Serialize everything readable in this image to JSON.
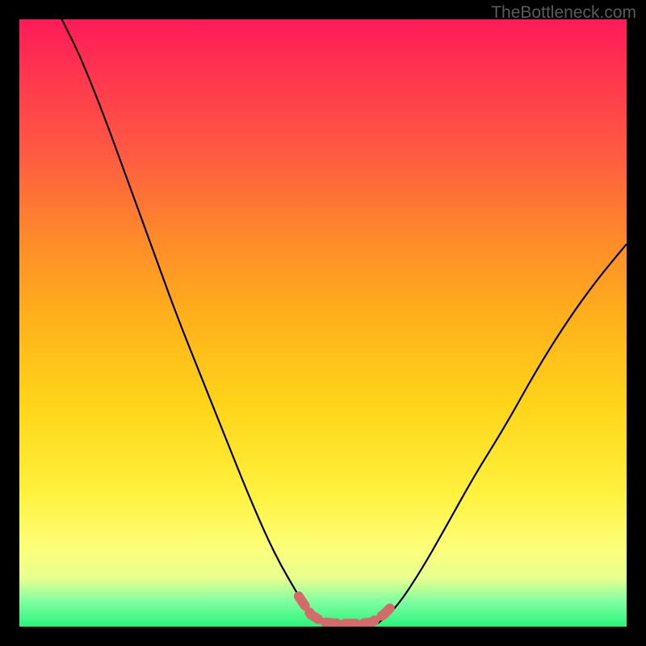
{
  "watermark": "TheBottleneck.com",
  "chart_data": {
    "type": "line",
    "title": "",
    "xlabel": "",
    "ylabel": "",
    "xlim": [
      0,
      100
    ],
    "ylim": [
      0,
      100
    ],
    "series": [
      {
        "name": "left-curve",
        "type": "line",
        "points": [
          {
            "x": 7,
            "y": 100
          },
          {
            "x": 10,
            "y": 94
          },
          {
            "x": 14,
            "y": 84
          },
          {
            "x": 18,
            "y": 73
          },
          {
            "x": 22,
            "y": 62
          },
          {
            "x": 26,
            "y": 51
          },
          {
            "x": 30,
            "y": 41
          },
          {
            "x": 34,
            "y": 31
          },
          {
            "x": 38,
            "y": 21
          },
          {
            "x": 42,
            "y": 12
          },
          {
            "x": 46,
            "y": 5
          },
          {
            "x": 48,
            "y": 2
          },
          {
            "x": 50,
            "y": 0.5
          }
        ]
      },
      {
        "name": "right-curve",
        "type": "line",
        "points": [
          {
            "x": 59,
            "y": 0.5
          },
          {
            "x": 62,
            "y": 3
          },
          {
            "x": 66,
            "y": 9
          },
          {
            "x": 70,
            "y": 16
          },
          {
            "x": 75,
            "y": 25
          },
          {
            "x": 80,
            "y": 33
          },
          {
            "x": 85,
            "y": 42
          },
          {
            "x": 90,
            "y": 50
          },
          {
            "x": 95,
            "y": 57
          },
          {
            "x": 100,
            "y": 63
          }
        ]
      },
      {
        "name": "bottom-highlight",
        "type": "line",
        "points": [
          {
            "x": 46,
            "y": 5
          },
          {
            "x": 48,
            "y": 2
          },
          {
            "x": 50,
            "y": 0.7
          },
          {
            "x": 53,
            "y": 0.5
          },
          {
            "x": 56,
            "y": 0.5
          },
          {
            "x": 58,
            "y": 0.7
          },
          {
            "x": 60,
            "y": 2
          },
          {
            "x": 61.5,
            "y": 3.5
          }
        ]
      }
    ],
    "background_gradient": {
      "stops": [
        {
          "pos": 0,
          "color": "#ff1a58"
        },
        {
          "pos": 0.36,
          "color": "#ff8a2a"
        },
        {
          "pos": 0.78,
          "color": "#fff13d"
        },
        {
          "pos": 1.0,
          "color": "#29f37a"
        }
      ]
    },
    "highlight_color": "#d46a6a"
  }
}
